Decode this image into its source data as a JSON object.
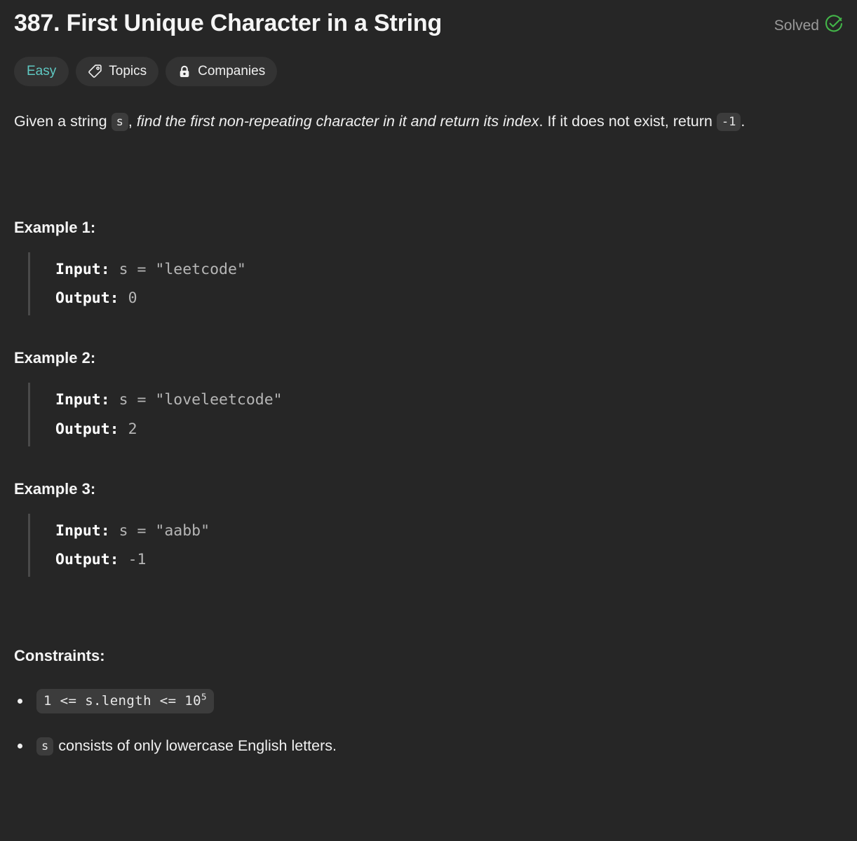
{
  "header": {
    "title": "387. First Unique Character in a String",
    "status_label": "Solved",
    "status_icon": "check-circle-icon",
    "status_color": "#43b649"
  },
  "badges": [
    {
      "label": "Easy",
      "icon": null,
      "color": "#5fc8c2"
    },
    {
      "label": "Topics",
      "icon": "tag-icon",
      "color": "#f0f0f0"
    },
    {
      "label": "Companies",
      "icon": "lock-icon",
      "color": "#f0f0f0"
    }
  ],
  "description": {
    "part1": "Given a string",
    "code_s": "s",
    "part2": ",",
    "emphasis": "find the first non-repeating character in it and return its index",
    "part3": ". If it does not exist, return",
    "code_minus_one": "-1",
    "part4": "."
  },
  "examples": [
    {
      "heading": "Example 1:",
      "input_label": "Input:",
      "input_value": "s = \"leetcode\"",
      "output_label": "Output:",
      "output_value": "0"
    },
    {
      "heading": "Example 2:",
      "input_label": "Input:",
      "input_value": "s = \"loveleetcode\"",
      "output_label": "Output:",
      "output_value": "2"
    },
    {
      "heading": "Example 3:",
      "input_label": "Input:",
      "input_value": "s = \"aabb\"",
      "output_label": "Output:",
      "output_value": "-1"
    }
  ],
  "constraints": {
    "heading": "Constraints:",
    "items": [
      {
        "code_prefix": "1 <= s.length <= 10",
        "code_superscript": "5",
        "text": ""
      },
      {
        "code_prefix": "s",
        "code_superscript": "",
        "text": "consists of only lowercase English letters."
      }
    ]
  },
  "colors": {
    "background": "#262626",
    "chip_background": "#3c3c3c",
    "badge_background": "#333333",
    "text_primary": "#f0f0f0",
    "text_muted": "#b6b6b6",
    "border_bar": "#4a4a4a"
  }
}
